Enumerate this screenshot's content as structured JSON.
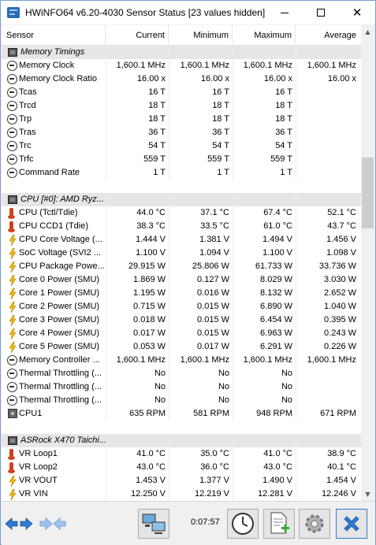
{
  "window": {
    "title": "HWiNFO64 v6.20-4030 Sensor Status [23 values hidden]",
    "minimize_label": "",
    "maximize_label": "",
    "close_label": "✕"
  },
  "columns": {
    "sensor": "Sensor",
    "current": "Current",
    "minimum": "Minimum",
    "maximum": "Maximum",
    "average": "Average"
  },
  "rows": [
    {
      "kind": "group",
      "icon": "chip-icon",
      "name": "Memory Timings"
    },
    {
      "kind": "item",
      "icon": "gauge-icon",
      "name": "Memory Clock",
      "current": "1,600.1 MHz",
      "minimum": "1,600.1 MHz",
      "maximum": "1,600.1 MHz",
      "average": "1,600.1 MHz"
    },
    {
      "kind": "item",
      "icon": "gauge-icon",
      "name": "Memory Clock Ratio",
      "current": "16.00 x",
      "minimum": "16.00 x",
      "maximum": "16.00 x",
      "average": "16.00 x"
    },
    {
      "kind": "item",
      "icon": "gauge-icon",
      "name": "Tcas",
      "current": "16 T",
      "minimum": "16 T",
      "maximum": "16 T",
      "average": ""
    },
    {
      "kind": "item",
      "icon": "gauge-icon",
      "name": "Trcd",
      "current": "18 T",
      "minimum": "18 T",
      "maximum": "18 T",
      "average": ""
    },
    {
      "kind": "item",
      "icon": "gauge-icon",
      "name": "Trp",
      "current": "18 T",
      "minimum": "18 T",
      "maximum": "18 T",
      "average": ""
    },
    {
      "kind": "item",
      "icon": "gauge-icon",
      "name": "Tras",
      "current": "36 T",
      "minimum": "36 T",
      "maximum": "36 T",
      "average": ""
    },
    {
      "kind": "item",
      "icon": "gauge-icon",
      "name": "Trc",
      "current": "54 T",
      "minimum": "54 T",
      "maximum": "54 T",
      "average": ""
    },
    {
      "kind": "item",
      "icon": "gauge-icon",
      "name": "Trfc",
      "current": "559 T",
      "minimum": "559 T",
      "maximum": "559 T",
      "average": ""
    },
    {
      "kind": "item",
      "icon": "gauge-icon",
      "name": "Command Rate",
      "current": "1 T",
      "minimum": "1 T",
      "maximum": "1 T",
      "average": ""
    },
    {
      "kind": "spacer"
    },
    {
      "kind": "group",
      "icon": "chip-icon",
      "name": "CPU [#0]: AMD Ryz..."
    },
    {
      "kind": "item",
      "icon": "thermometer-icon",
      "name": "CPU (Tctl/Tdie)",
      "current": "44.0 °C",
      "minimum": "37.1 °C",
      "maximum": "67.4 °C",
      "average": "52.1 °C"
    },
    {
      "kind": "item",
      "icon": "thermometer-icon",
      "name": "CPU CCD1 (Tdie)",
      "current": "38.3 °C",
      "minimum": "33.5 °C",
      "maximum": "61.0 °C",
      "average": "43.7 °C"
    },
    {
      "kind": "item",
      "icon": "lightning-icon",
      "name": "CPU Core Voltage (...",
      "current": "1.444 V",
      "minimum": "1.381 V",
      "maximum": "1.494 V",
      "average": "1.456 V"
    },
    {
      "kind": "item",
      "icon": "lightning-icon",
      "name": "SoC Voltage (SVI2 ...",
      "current": "1.100 V",
      "minimum": "1.094 V",
      "maximum": "1.100 V",
      "average": "1.098 V"
    },
    {
      "kind": "item",
      "icon": "lightning-icon",
      "name": "CPU Package Powe...",
      "current": "29.915 W",
      "minimum": "25.806 W",
      "maximum": "61.733 W",
      "average": "33.736 W"
    },
    {
      "kind": "item",
      "icon": "lightning-icon",
      "name": "Core 0 Power (SMU)",
      "current": "1.869 W",
      "minimum": "0.127 W",
      "maximum": "8.029 W",
      "average": "3.030 W"
    },
    {
      "kind": "item",
      "icon": "lightning-icon",
      "name": "Core 1 Power (SMU)",
      "current": "1.195 W",
      "minimum": "0.016 W",
      "maximum": "8.132 W",
      "average": "2.652 W"
    },
    {
      "kind": "item",
      "icon": "lightning-icon",
      "name": "Core 2 Power (SMU)",
      "current": "0.715 W",
      "minimum": "0.015 W",
      "maximum": "6.890 W",
      "average": "1.040 W"
    },
    {
      "kind": "item",
      "icon": "lightning-icon",
      "name": "Core 3 Power (SMU)",
      "current": "0.018 W",
      "minimum": "0.015 W",
      "maximum": "6.454 W",
      "average": "0.395 W"
    },
    {
      "kind": "item",
      "icon": "lightning-icon",
      "name": "Core 4 Power (SMU)",
      "current": "0.017 W",
      "minimum": "0.015 W",
      "maximum": "6.963 W",
      "average": "0.243 W"
    },
    {
      "kind": "item",
      "icon": "lightning-icon",
      "name": "Core 5 Power (SMU)",
      "current": "0.053 W",
      "minimum": "0.017 W",
      "maximum": "6.291 W",
      "average": "0.226 W"
    },
    {
      "kind": "item",
      "icon": "gauge-icon",
      "name": "Memory Controller ...",
      "current": "1,600.1 MHz",
      "minimum": "1,600.1 MHz",
      "maximum": "1,600.1 MHz",
      "average": "1,600.1 MHz"
    },
    {
      "kind": "item",
      "icon": "gauge-icon",
      "name": "Thermal Throttling (...",
      "current": "No",
      "minimum": "No",
      "maximum": "No",
      "average": ""
    },
    {
      "kind": "item",
      "icon": "gauge-icon",
      "name": "Thermal Throttling (...",
      "current": "No",
      "minimum": "No",
      "maximum": "No",
      "average": ""
    },
    {
      "kind": "item",
      "icon": "gauge-icon",
      "name": "Thermal Throttling (...",
      "current": "No",
      "minimum": "No",
      "maximum": "No",
      "average": ""
    },
    {
      "kind": "item",
      "icon": "fan-icon",
      "name": "CPU1",
      "current": "635 RPM",
      "minimum": "581 RPM",
      "maximum": "948 RPM",
      "average": "671 RPM"
    },
    {
      "kind": "spacer"
    },
    {
      "kind": "group",
      "icon": "chip-icon",
      "name": "ASRock X470 Taichi..."
    },
    {
      "kind": "item",
      "icon": "thermometer-icon",
      "name": "VR Loop1",
      "current": "41.0 °C",
      "minimum": "35.0 °C",
      "maximum": "41.0 °C",
      "average": "38.9 °C"
    },
    {
      "kind": "item",
      "icon": "thermometer-icon",
      "name": "VR Loop2",
      "current": "43.0 °C",
      "minimum": "36.0 °C",
      "maximum": "43.0 °C",
      "average": "40.1 °C"
    },
    {
      "kind": "item",
      "icon": "lightning-icon",
      "name": "VR VOUT",
      "current": "1.453 V",
      "minimum": "1.377 V",
      "maximum": "1.490 V",
      "average": "1.454 V"
    },
    {
      "kind": "item",
      "icon": "lightning-icon",
      "name": "VR VIN",
      "current": "12.250 V",
      "minimum": "12.219 V",
      "maximum": "12.281 V",
      "average": "12.246 V"
    }
  ],
  "toolbar": {
    "elapsed_time": "0:07:57",
    "buttons": [
      "expand-arrows-icon",
      "collapse-arrows-icon",
      "network-computers-icon",
      "clock-icon",
      "add-report-icon",
      "settings-gear-icon",
      "close-x-icon"
    ]
  },
  "colors": {
    "accent": "#2f7bd4",
    "group_row": "#e6e6e6",
    "lightning": "#f2b800",
    "thermometer": "#d04020"
  }
}
